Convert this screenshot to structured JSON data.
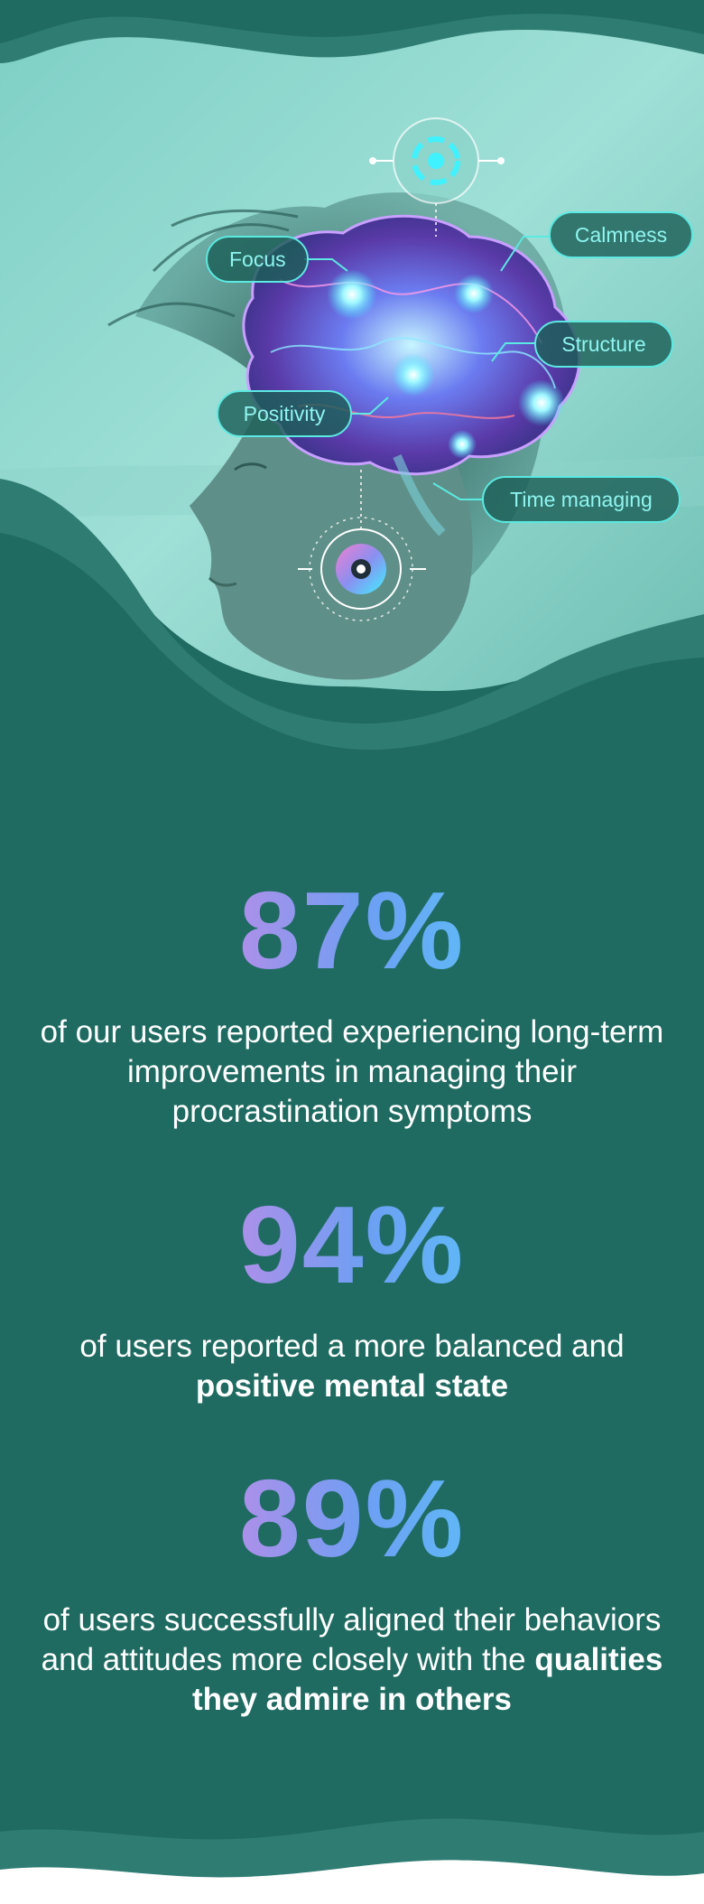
{
  "colors": {
    "background": "#1f6b61",
    "wave_light": "#2f7c73",
    "accent_cyan": "#5ce9e1",
    "gradient_pink": "#f27fd0",
    "gradient_blue": "#6d9ff3",
    "gradient_cyan": "#40f1ff",
    "text": "#ffffff"
  },
  "hero": {
    "labels": {
      "focus": "Focus",
      "calmness": "Calmness",
      "structure": "Structure",
      "positivity": "Positivity",
      "time_managing": "Time managing"
    },
    "icons": [
      "brain-icon",
      "target-ring-icon",
      "dial-icon"
    ]
  },
  "stats": [
    {
      "value": "87%",
      "text": "of our users reported experiencing long-term improvements in managing their procrastination symptoms",
      "highlight": ""
    },
    {
      "value": "94%",
      "text": "of users reported a more balanced and",
      "highlight": "positive mental state"
    },
    {
      "value": "89%",
      "text": "of users successfully aligned their behaviors and attitudes more closely with the",
      "highlight": "qualities they admire in others"
    }
  ]
}
